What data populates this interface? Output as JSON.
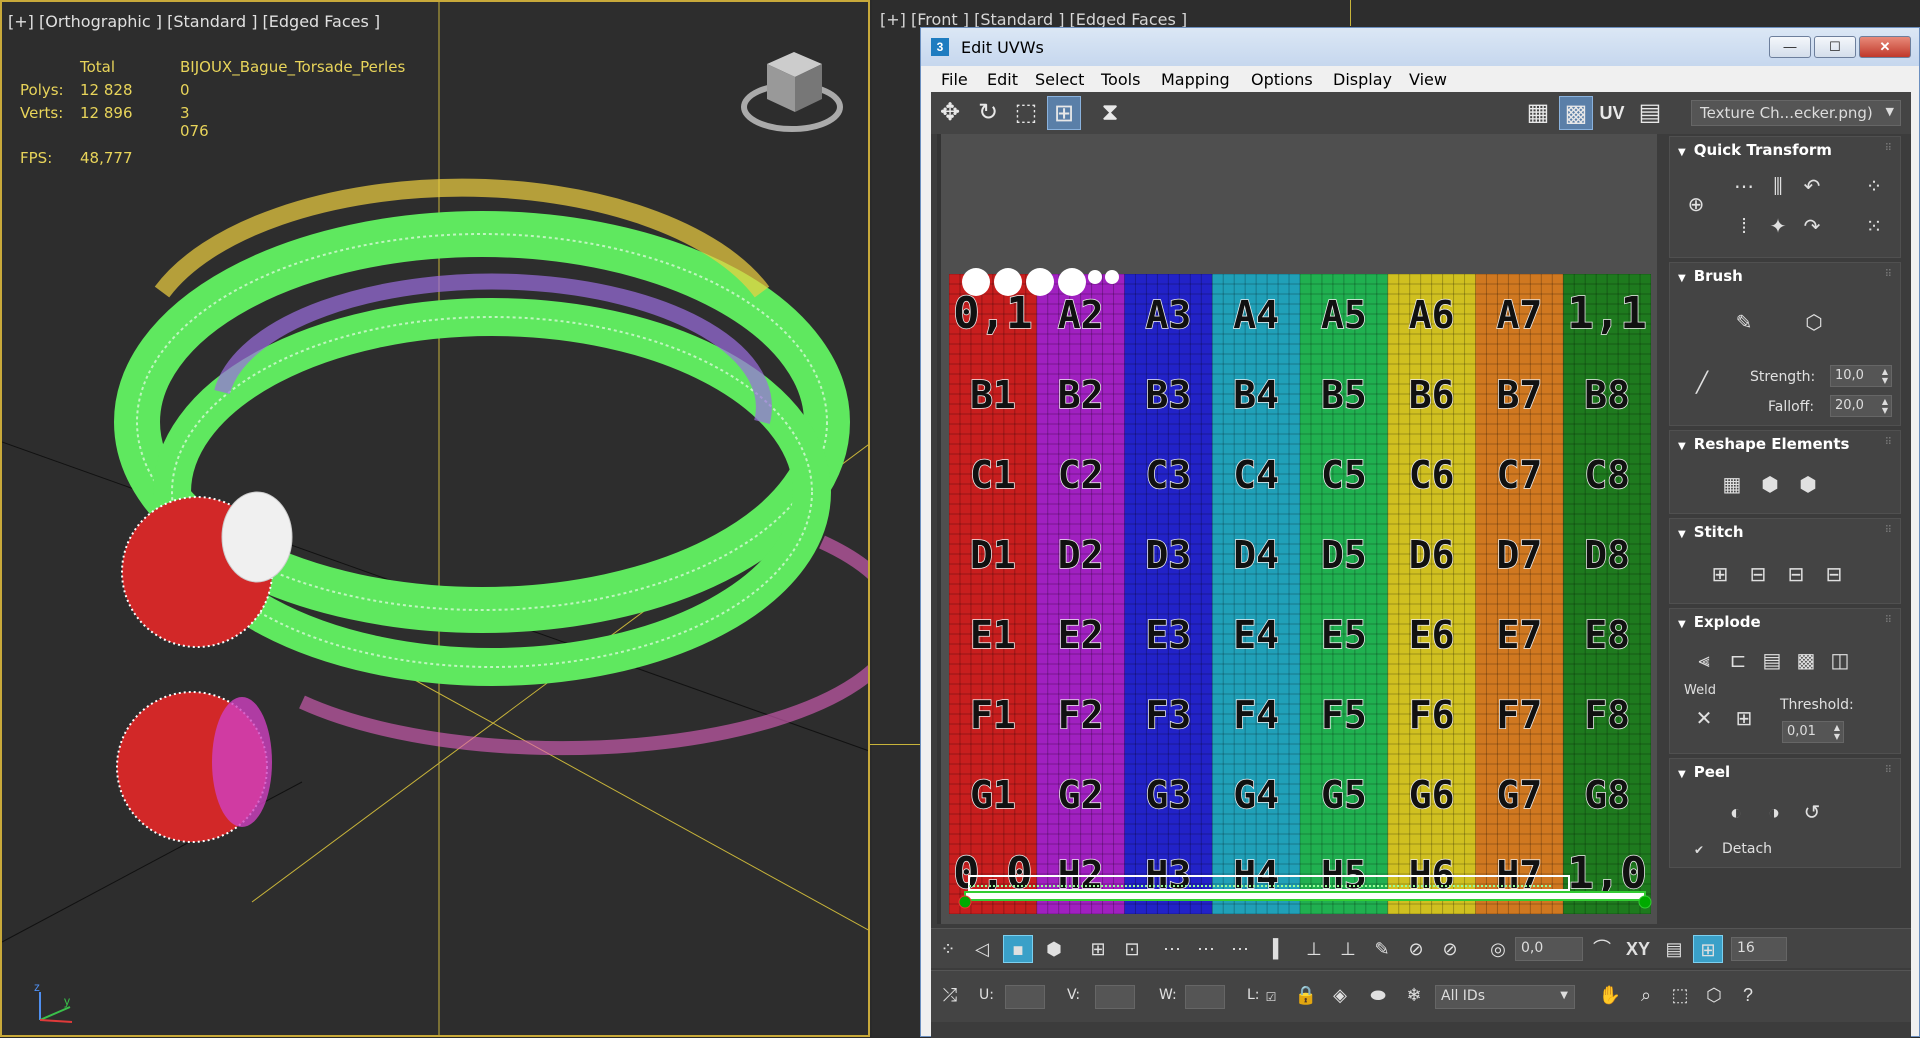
{
  "left_viewport": {
    "label": "[+] [Orthographic ] [Standard ] [Edged Faces ]",
    "stats": {
      "header_total": "Total",
      "header_object": "BIJOUX_Bague_Torsade_Perles",
      "polys_label": "Polys:",
      "polys_total": "12 828",
      "polys_object": "0",
      "verts_label": "Verts:",
      "verts_total": "12 896",
      "verts_object": "3 076",
      "fps_label": "FPS:",
      "fps_value": "48,777"
    },
    "axis_x": "x",
    "axis_y": "y",
    "axis_z": "z"
  },
  "right_viewport": {
    "label": "[+] [Front ] [Standard ] [Edged Faces ]"
  },
  "uvw_window": {
    "app_icon": "3",
    "title": "Edit UVWs",
    "minimize": "—",
    "maximize": "☐",
    "close": "✕",
    "menu": [
      "File",
      "Edit",
      "Select",
      "Tools",
      "Mapping",
      "Options",
      "Display",
      "View"
    ],
    "uv_label": "UV",
    "texture_select": "Texture Ch...ecker.png)",
    "checker_rows": [
      "0,1",
      "A",
      "B",
      "C",
      "D",
      "E",
      "F",
      "G",
      "0,0"
    ],
    "checker_labels": [
      [
        "0,1",
        "A2",
        "A3",
        "A4",
        "A5",
        "A6",
        "A7",
        "1,1"
      ],
      [
        "B1",
        "B2",
        "B3",
        "B4",
        "B5",
        "B6",
        "B7",
        "B8"
      ],
      [
        "C1",
        "C2",
        "C3",
        "C4",
        "C5",
        "C6",
        "C7",
        "C8"
      ],
      [
        "D1",
        "D2",
        "D3",
        "D4",
        "D5",
        "D6",
        "D7",
        "D8"
      ],
      [
        "E1",
        "E2",
        "E3",
        "E4",
        "E5",
        "E6",
        "E7",
        "E8"
      ],
      [
        "F1",
        "F2",
        "F3",
        "F4",
        "F5",
        "F6",
        "F7",
        "F8"
      ],
      [
        "G1",
        "G2",
        "G3",
        "G4",
        "G5",
        "G6",
        "G7",
        "G8"
      ],
      [
        "0,0",
        "H2",
        "H3",
        "H4",
        "H5",
        "H6",
        "H7",
        "1,0"
      ]
    ],
    "column_colors": [
      "#c81e1e",
      "#a020c0",
      "#2222c8",
      "#20a0b8",
      "#20b050",
      "#d0c020",
      "#d07820",
      "#1e7a1e"
    ],
    "panels": {
      "quick_transform": "Quick Transform",
      "brush": "Brush",
      "strength_label": "Strength:",
      "strength_value": "10,0",
      "falloff_label": "Falloff:",
      "falloff_value": "20,0",
      "reshape_elements": "Reshape Elements",
      "stitch": "Stitch",
      "explode": "Explode",
      "weld_label": "Weld",
      "threshold_label": "Threshold:",
      "threshold_value": "0,01",
      "peel": "Peel",
      "detach_label": "Detach",
      "detach_checked": "✔"
    },
    "bottom": {
      "rotation_value": "0,0",
      "xy_label": "XY",
      "grid_value": "16",
      "u_label": "U:",
      "v_label": "V:",
      "w_label": "W:",
      "l_label": "L:",
      "ids_select": "All IDs"
    }
  }
}
